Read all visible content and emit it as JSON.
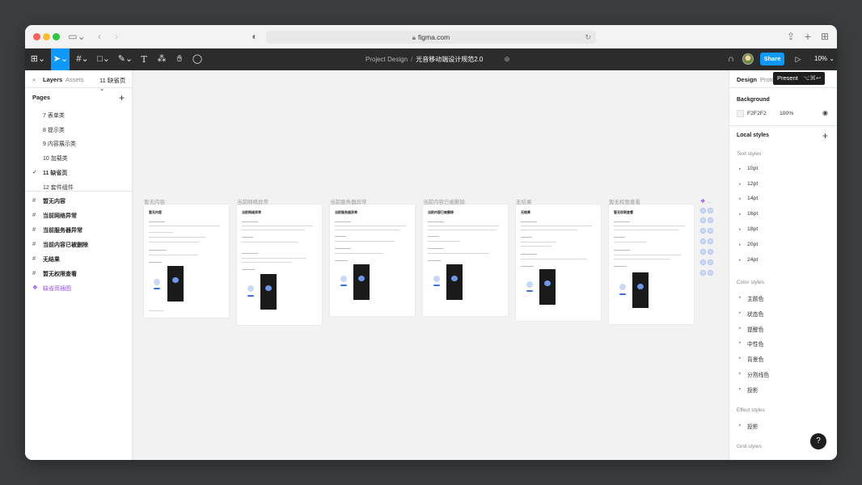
{
  "browser": {
    "url": "figma.com",
    "colors": {
      "close": "#ff5f57",
      "minimize": "#febc2e",
      "maximize": "#28c840"
    }
  },
  "toolbar": {
    "project": "Project Design",
    "separator": "/",
    "file": "光音移动端设计规范2.0",
    "share_label": "Share",
    "zoom": "10%",
    "tooltip_label": "Present",
    "tooltip_shortcut": "⌥⌘↩",
    "accent": "#0d99ff"
  },
  "left": {
    "tabs": [
      "Layers",
      "Assets",
      "11 缺省页 ⌄"
    ],
    "pages_title": "Pages",
    "pages": [
      "7 表单类",
      "8 提示类",
      "9 内容展示类",
      "10 加载类",
      "11 缺省页",
      "12 套件组件"
    ],
    "current_page_index": 4,
    "layers": [
      "暂无内容",
      "当前网络异常",
      "当前服务器异常",
      "当前内容已被删除",
      "无结果",
      "暂无权限查看",
      "缺省页插图"
    ]
  },
  "canvas": {
    "frames": [
      {
        "label": "暂无内容",
        "title": "暂无内容"
      },
      {
        "label": "当前网络异常",
        "title": "当前网络异常"
      },
      {
        "label": "当前服务器异常",
        "title": "当前服务器异常"
      },
      {
        "label": "当前内容已被删除",
        "title": "当前内容已被删除"
      },
      {
        "label": "无结果",
        "title": "无结果"
      },
      {
        "label": "暂无权限查看",
        "title": "暂无权限查看"
      }
    ]
  },
  "right": {
    "tabs": [
      "Design",
      "Proto"
    ],
    "background_title": "Background",
    "bg_hex": "F2F2F2",
    "bg_opacity": "100%",
    "local_styles": "Local styles",
    "text_styles_title": "Text styles",
    "text_styles": [
      "10pt",
      "12pt",
      "14pt",
      "16pt",
      "18pt",
      "20pt",
      "24pt"
    ],
    "color_styles_title": "Color styles",
    "color_styles": [
      "主题色",
      "状态色",
      "提醒色",
      "中性色",
      "背景色",
      "分割线色",
      "投影"
    ],
    "effect_styles_title": "Effect styles",
    "effect_styles": [
      "投影"
    ],
    "grid_styles_title": "Grid styles"
  },
  "help_label": "?"
}
